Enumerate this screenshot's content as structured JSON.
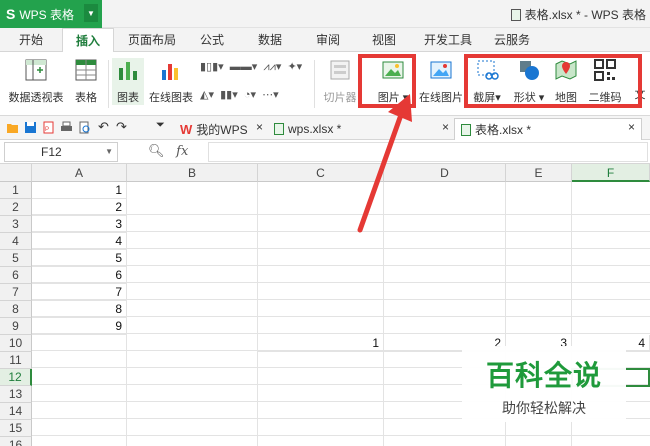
{
  "app": {
    "button_label": "WPS 表格",
    "logo": "S",
    "doc_title": "表格.xlsx * - WPS 表格"
  },
  "menu": {
    "tabs": [
      "开始",
      "插入",
      "页面布局",
      "公式",
      "数据",
      "审阅",
      "视图",
      "开发工具",
      "云服务"
    ],
    "active_tab": "插入"
  },
  "ribbon": {
    "pivot_table": "数据透视表",
    "table": "表格",
    "chart": "图表",
    "online_chart": "在线图表",
    "slicer": "切片器",
    "picture": "图片",
    "online_picture": "在线图片",
    "screenshot": "截屏",
    "shapes": "形状",
    "map": "地图",
    "qrcode": "二维码",
    "text_partial": "文"
  },
  "doc_tabs": [
    {
      "label": "我的WPS"
    },
    {
      "label": "wps.xlsx *"
    },
    {
      "label": "表格.xlsx *"
    }
  ],
  "formula_bar": {
    "name_box": "F12",
    "fx": "fx",
    "value": ""
  },
  "sheet": {
    "columns": [
      "A",
      "B",
      "C",
      "D",
      "E",
      "F"
    ],
    "selected_column": "F",
    "selected_row": 12,
    "rows": [
      "1",
      "2",
      "3",
      "4",
      "5",
      "6",
      "7",
      "8",
      "9",
      "10",
      "11",
      "12",
      "13",
      "14",
      "15",
      "16"
    ],
    "col_a_values": [
      "1",
      "2",
      "3",
      "4",
      "5",
      "6",
      "7",
      "8",
      "9"
    ],
    "row10_values": [
      "1",
      "2",
      "3",
      "4"
    ]
  },
  "watermark": {
    "main": "百科全说",
    "sub": "助你轻松解决"
  },
  "colors": {
    "accent_green": "#23a24d",
    "highlight_red": "#e53935"
  }
}
